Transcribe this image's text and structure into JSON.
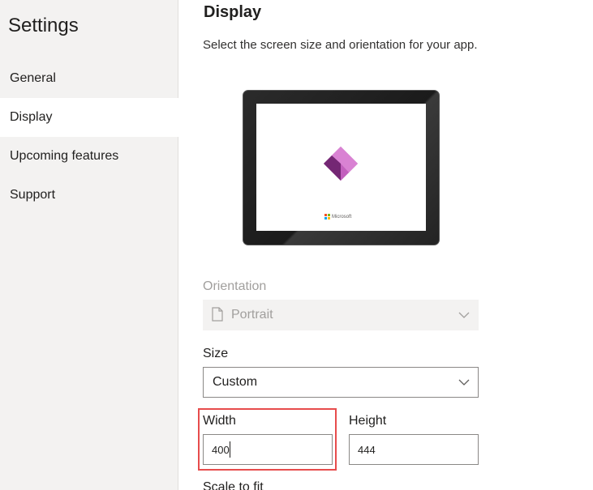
{
  "sidebar": {
    "title": "Settings",
    "items": [
      {
        "label": "General",
        "active": false
      },
      {
        "label": "Display",
        "active": true
      },
      {
        "label": "Upcoming features",
        "active": false
      },
      {
        "label": "Support",
        "active": false
      }
    ]
  },
  "main": {
    "title": "Display",
    "description": "Select the screen size and orientation for your app.",
    "preview": {
      "brand": "Microsoft",
      "icon": "power-apps-logo-icon"
    },
    "orientation": {
      "label": "Orientation",
      "value": "Portrait",
      "disabled": true,
      "icon": "document-portrait-icon"
    },
    "size": {
      "label": "Size",
      "value": "Custom"
    },
    "width": {
      "label": "Width",
      "value": "400"
    },
    "height": {
      "label": "Height",
      "value": "444"
    },
    "scale": {
      "label": "Scale to fit"
    }
  },
  "colors": {
    "sidebar_bg": "#f3f2f1",
    "highlight": "#e74c4c",
    "logo_dark": "#742774",
    "logo_light": "#d982d3"
  }
}
